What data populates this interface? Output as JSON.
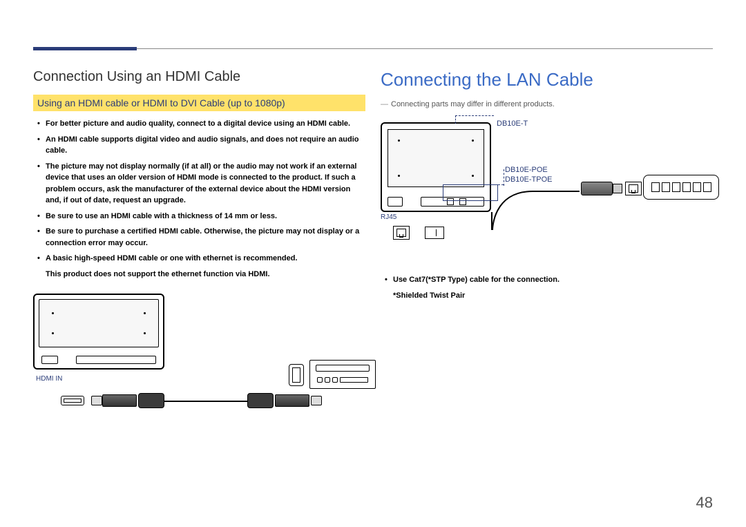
{
  "page_number": "48",
  "left": {
    "heading": "Connection Using an HDMI Cable",
    "yellow": "Using an HDMI cable or HDMI to DVI Cable (up to 1080p)",
    "bullets": [
      "For better picture and audio quality, connect to a digital device using an HDMI cable.",
      "An HDMI cable supports digital video and audio signals, and does not require an audio cable.",
      "The picture may not display normally (if at all) or the audio may not work if an external device that uses an older version of HDMI mode is connected to the product. If such a problem occurs, ask the manufacturer of the external device about the HDMI version and, if out of date, request an upgrade.",
      "Be sure to use an HDMI cable with a thickness of 14 mm or less.",
      "Be sure to purchase a certified HDMI cable. Otherwise, the picture may not display or a connection error may occur.",
      "A basic high-speed HDMI cable or one with ethernet is recommended."
    ],
    "subline": "This product does not support the ethernet function via HDMI.",
    "hdmi_in_label": "HDMI IN"
  },
  "right": {
    "heading": "Connecting the LAN Cable",
    "footnote": "Connecting parts may differ in different products.",
    "model_top": "DB10E-T",
    "model_a": "DB10E-POE",
    "model_b": "DB10E-TPOE",
    "rj45_label": "RJ45",
    "bullets": [
      "Use Cat7(*STP Type) cable for the connection."
    ],
    "subline": "*Shielded Twist Pair"
  }
}
